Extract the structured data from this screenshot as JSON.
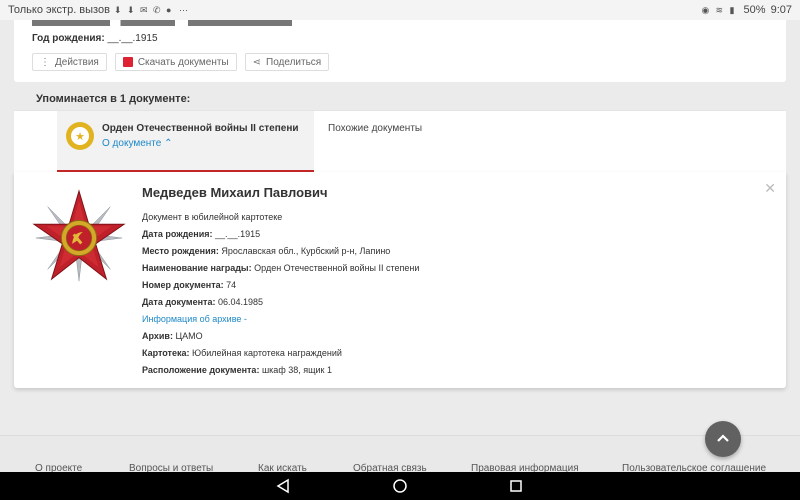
{
  "statusbar": {
    "carrier": "Только экстр. вызов",
    "battery": "50%",
    "time": "9:07"
  },
  "person_header": {
    "birth_label": "Год рождения:",
    "birth_value": "__.__.1915"
  },
  "actions": {
    "more_label": "Действия",
    "download_label": "Скачать документы",
    "share_label": "Поделиться"
  },
  "mentions": {
    "title": "Упоминается в 1 документе:",
    "tab_title": "Орден Отечественной войны II степени",
    "tab_link": "О документе",
    "similar": "Похожие документы"
  },
  "detail": {
    "name": "Медведев Михаил Павлович",
    "doc_type": "Документ в юбилейной картотеке",
    "birth_date_label": "Дата рождения:",
    "birth_date_value": "__.__.1915",
    "birthplace_label": "Место рождения:",
    "birthplace_value": "Ярославская обл., Курбский р-н, Лапино",
    "award_label": "Наименование награды:",
    "award_value": "Орден Отечественной войны II степени",
    "doc_number_label": "Номер документа:",
    "doc_number_value": "74",
    "doc_date_label": "Дата документа:",
    "doc_date_value": "06.04.1985",
    "archive_info_link": "Информация об архиве -",
    "archive_label": "Архив:",
    "archive_value": "ЦАМО",
    "cardfile_label": "Картотека:",
    "cardfile_value": "Юбилейная картотека награждений",
    "location_label": "Расположение документа:",
    "location_value": "шкаф 38, ящик 1"
  },
  "footer": {
    "links": [
      "О проекте",
      "Вопросы и ответы",
      "Как искать",
      "Обратная связь",
      "Правовая информация",
      "Пользовательское соглашение"
    ]
  },
  "icons": {
    "scroll_top": "chevron-up-icon",
    "nav_back": "back-triangle-icon",
    "nav_home": "home-circle-icon",
    "nav_recents": "recents-square-icon"
  },
  "colors": {
    "link": "#1e88c8",
    "accent_red": "#c62828",
    "medal_gold": "#e2b321"
  }
}
